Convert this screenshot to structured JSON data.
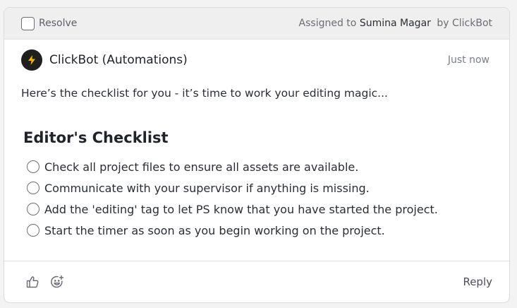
{
  "resolve": {
    "label": "Resolve",
    "checked": false
  },
  "assignment": {
    "prefix": "Assigned to",
    "assignee": "Sumina Magar",
    "by_text": "by ClickBot"
  },
  "comment": {
    "author": "ClickBot (Automations)",
    "avatar_icon": "lightning-icon",
    "timestamp": "Just now",
    "message": "Here’s the checklist for you - it’s time to work your editing magic...",
    "checklist_title": "Editor's Checklist",
    "checklist_items": [
      {
        "text": "Check all project files to ensure all assets are available.",
        "done": false
      },
      {
        "text": "Communicate with your supervisor if anything is missing.",
        "done": false
      },
      {
        "text": "Add the 'editing' tag to let PS know that you have started the project.",
        "done": false
      },
      {
        "text": "Start the timer as soon as you begin working on the project.",
        "done": false
      }
    ]
  },
  "footer": {
    "like_icon": "thumbs-up-icon",
    "emoji_icon": "add-reaction-icon",
    "reply_label": "Reply"
  },
  "colors": {
    "avatar_bg": "#1f1f1f",
    "bolt": "#f5b400",
    "topbar_bg": "#efefef"
  }
}
